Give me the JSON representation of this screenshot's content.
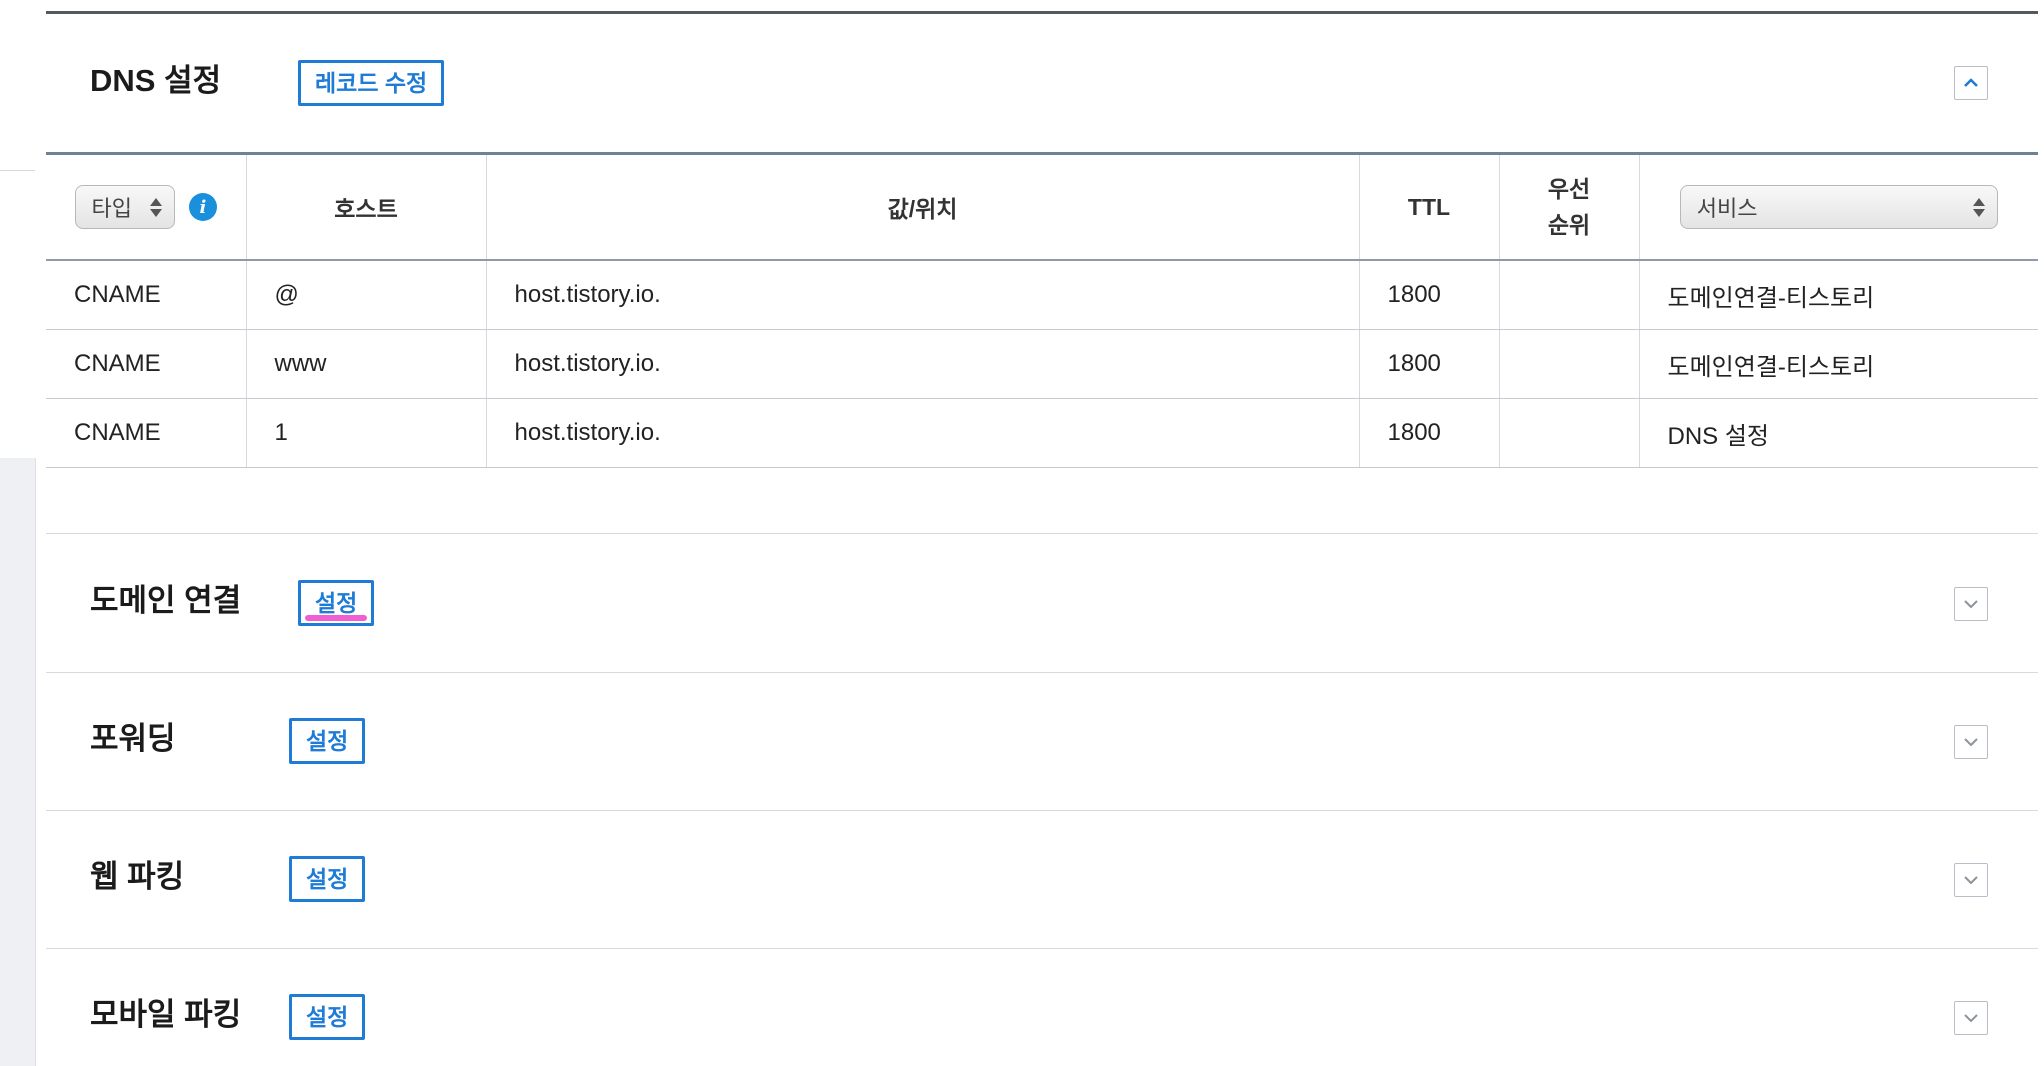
{
  "dns_section": {
    "title": "DNS 설정",
    "edit_button": "레코드 수정",
    "toggle_state": "expanded"
  },
  "table": {
    "headers": {
      "type_select": "타입",
      "host": "호스트",
      "value": "값/위치",
      "ttl": "TTL",
      "priority_line1": "우선",
      "priority_line2": "순위",
      "service_select": "서비스"
    },
    "rows": [
      {
        "type": "CNAME",
        "host": "@",
        "value": "host.tistory.io.",
        "ttl": "1800",
        "priority": "",
        "service": "도메인연결-티스토리"
      },
      {
        "type": "CNAME",
        "host": "www",
        "value": "host.tistory.io.",
        "ttl": "1800",
        "priority": "",
        "service": "도메인연결-티스토리"
      },
      {
        "type": "CNAME",
        "host": "1",
        "value": "host.tistory.io.",
        "ttl": "1800",
        "priority": "",
        "service": "DNS 설정"
      }
    ]
  },
  "sections": [
    {
      "title": "도메인 연결",
      "button": "설정",
      "toggle_state": "collapsed",
      "highlighted": true
    },
    {
      "title": "포워딩",
      "button": "설정",
      "toggle_state": "collapsed",
      "highlighted": false
    },
    {
      "title": "웹 파킹",
      "button": "설정",
      "toggle_state": "collapsed",
      "highlighted": false
    },
    {
      "title": "모바일 파킹",
      "button": "설정",
      "toggle_state": "collapsed",
      "highlighted": false
    }
  ],
  "colors": {
    "accent_blue": "#1e7bd6",
    "highlight_pink": "#ef5fd2",
    "info_blue": "#1a8fdc"
  },
  "icons": {
    "collapse": "chevron-up-icon",
    "expand": "chevron-down-icon",
    "info": "info-icon"
  }
}
